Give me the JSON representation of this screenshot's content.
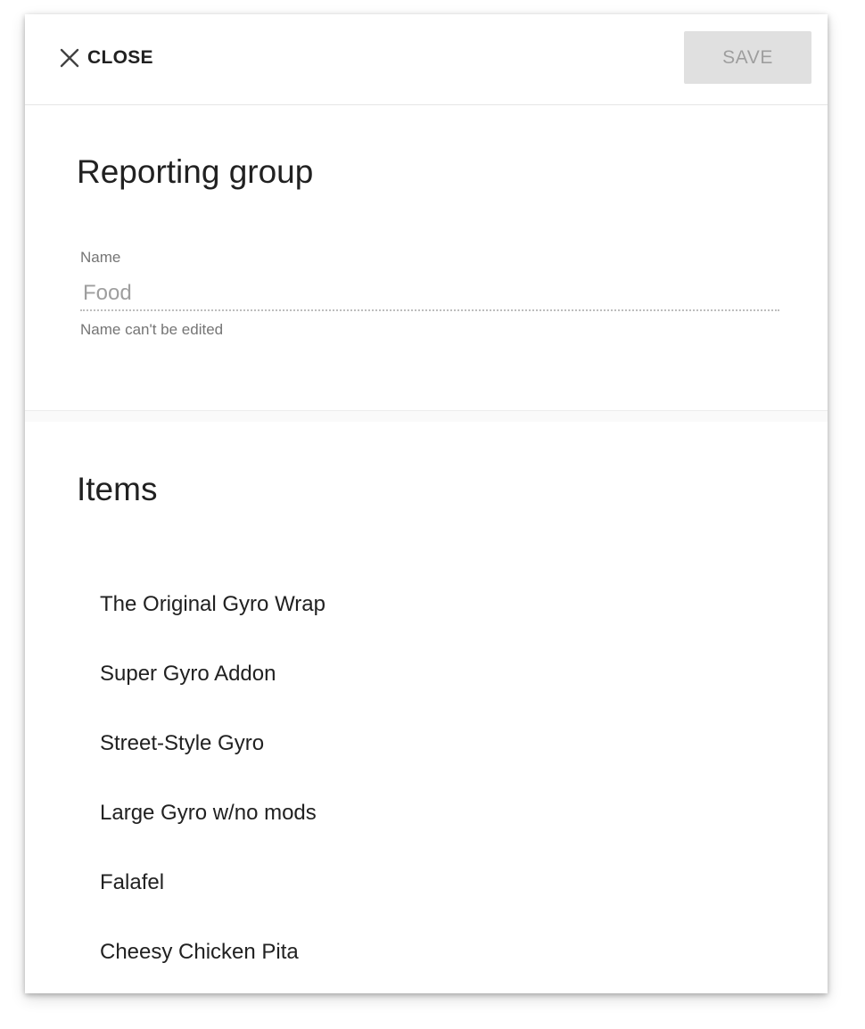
{
  "toolbar": {
    "close_label": "CLOSE",
    "save_label": "SAVE"
  },
  "reporting_group": {
    "title": "Reporting group",
    "name_label": "Name",
    "name_value": "Food",
    "name_hint": "Name can't be edited"
  },
  "items": {
    "title": "Items",
    "list": [
      "The Original Gyro Wrap",
      "Super Gyro Addon",
      "Street-Style Gyro",
      "Large Gyro w/no mods",
      "Falafel",
      "Cheesy Chicken Pita"
    ]
  },
  "colors": {
    "save_button_bg": "#e0e0e0",
    "save_button_text": "#9e9e9e",
    "text_primary": "#212121",
    "text_secondary": "#757575"
  },
  "icons": {
    "close": "close-icon"
  }
}
